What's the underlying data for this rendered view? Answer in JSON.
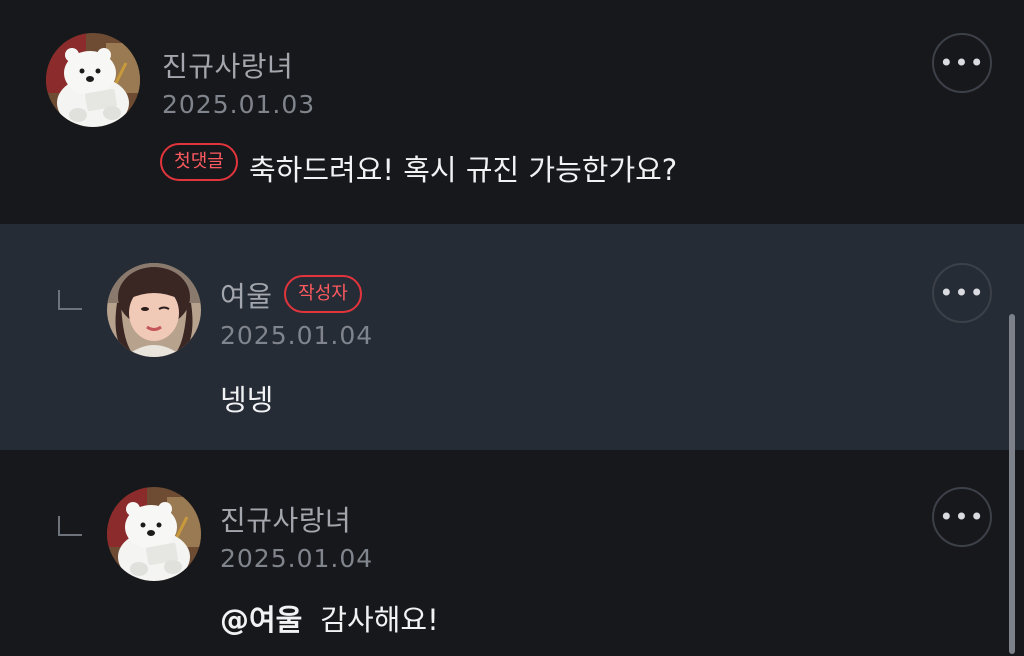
{
  "comments": [
    {
      "author": "진규사랑녀",
      "date": "2025.01.03",
      "badge": "첫댓글",
      "text": "축하드려요! 혹시 규진 가능한가요?",
      "avatar_icon": "polar-bear-avatar",
      "more_icon": "more-dots-icon"
    },
    {
      "author": "여울",
      "date": "2025.01.04",
      "badge": "작성자",
      "text": "넹넹",
      "avatar_icon": "user-photo-avatar",
      "more_icon": "more-dots-icon"
    },
    {
      "author": "진규사랑녀",
      "date": "2025.01.04",
      "mention": "@여울",
      "text": "감사해요!",
      "avatar_icon": "polar-bear-avatar",
      "more_icon": "more-dots-icon"
    }
  ],
  "more_symbol": "•••",
  "colors": {
    "background": "#17181b",
    "highlight_background": "#262c35",
    "badge_accent": "#e2343d",
    "primary_text": "#f1f2f4",
    "secondary_text": "#a3a6ad"
  }
}
